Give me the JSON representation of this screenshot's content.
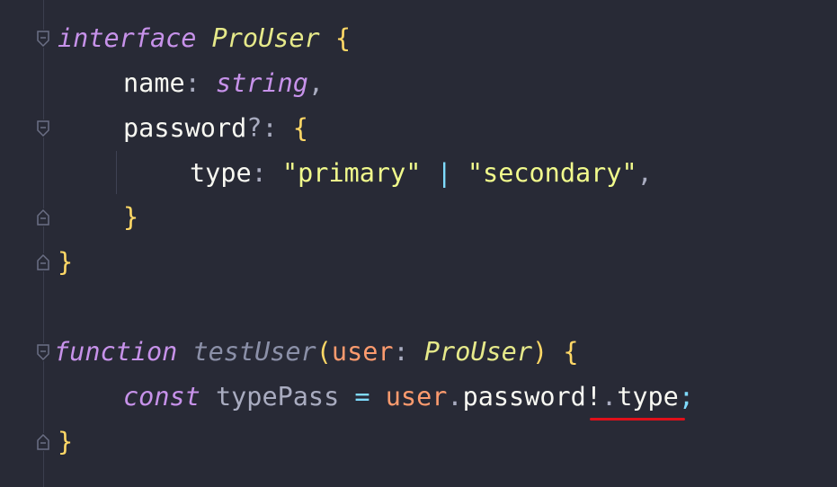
{
  "editor": {
    "theme_colors": {
      "background": "#282a36",
      "keyword": "#c792ea",
      "type": "#e6e98a",
      "string": "#f1fa8c",
      "param": "#fd9b6e",
      "brace": "#ffd866",
      "error_underline": "#e0101a"
    },
    "lines": [
      {
        "tokens": [
          {
            "text": "interface",
            "kind": "kw"
          },
          {
            "text": " ",
            "kind": "ws"
          },
          {
            "text": "ProUser",
            "kind": "type-name"
          },
          {
            "text": " ",
            "kind": "ws"
          },
          {
            "text": "{",
            "kind": "punct-brace"
          }
        ]
      },
      {
        "tokens": [
          {
            "text": "name",
            "kind": "prop"
          },
          {
            "text": ": ",
            "kind": "punct"
          },
          {
            "text": "string",
            "kind": "kw"
          },
          {
            "text": ",",
            "kind": "punct"
          }
        ]
      },
      {
        "tokens": [
          {
            "text": "password",
            "kind": "prop"
          },
          {
            "text": "?: ",
            "kind": "punct"
          },
          {
            "text": "{",
            "kind": "punct-brace"
          }
        ]
      },
      {
        "tokens": [
          {
            "text": "type",
            "kind": "prop"
          },
          {
            "text": ": ",
            "kind": "punct"
          },
          {
            "text": "\"primary\"",
            "kind": "str"
          },
          {
            "text": " | ",
            "kind": "op"
          },
          {
            "text": "\"secondary\"",
            "kind": "str"
          },
          {
            "text": ",",
            "kind": "punct"
          }
        ]
      },
      {
        "tokens": [
          {
            "text": "}",
            "kind": "punct-brace"
          }
        ]
      },
      {
        "tokens": [
          {
            "text": "}",
            "kind": "punct-brace"
          }
        ]
      },
      {
        "tokens": [
          {
            "text": "function",
            "kind": "kw"
          },
          {
            "text": " ",
            "kind": "ws"
          },
          {
            "text": "testUser",
            "kind": "fn-name"
          },
          {
            "text": "(",
            "kind": "punct-brace"
          },
          {
            "text": "user",
            "kind": "param"
          },
          {
            "text": ": ",
            "kind": "punct"
          },
          {
            "text": "ProUser",
            "kind": "type-name"
          },
          {
            "text": ") ",
            "kind": "punct-brace"
          },
          {
            "text": "{",
            "kind": "punct-brace"
          }
        ]
      },
      {
        "tokens": [
          {
            "text": "const",
            "kind": "kw"
          },
          {
            "text": " ",
            "kind": "ws"
          },
          {
            "text": "typePass",
            "kind": "ident-dim"
          },
          {
            "text": " ",
            "kind": "ws"
          },
          {
            "text": "=",
            "kind": "op"
          },
          {
            "text": " ",
            "kind": "ws"
          },
          {
            "text": "user",
            "kind": "param"
          },
          {
            "text": ".",
            "kind": "punct"
          },
          {
            "text": "password!",
            "kind": "ident"
          },
          {
            "text": ".",
            "kind": "punct"
          },
          {
            "text": "type",
            "kind": "ident"
          },
          {
            "text": ";",
            "kind": "op"
          }
        ]
      },
      {
        "tokens": [
          {
            "text": "}",
            "kind": "punct-brace"
          }
        ]
      }
    ]
  }
}
